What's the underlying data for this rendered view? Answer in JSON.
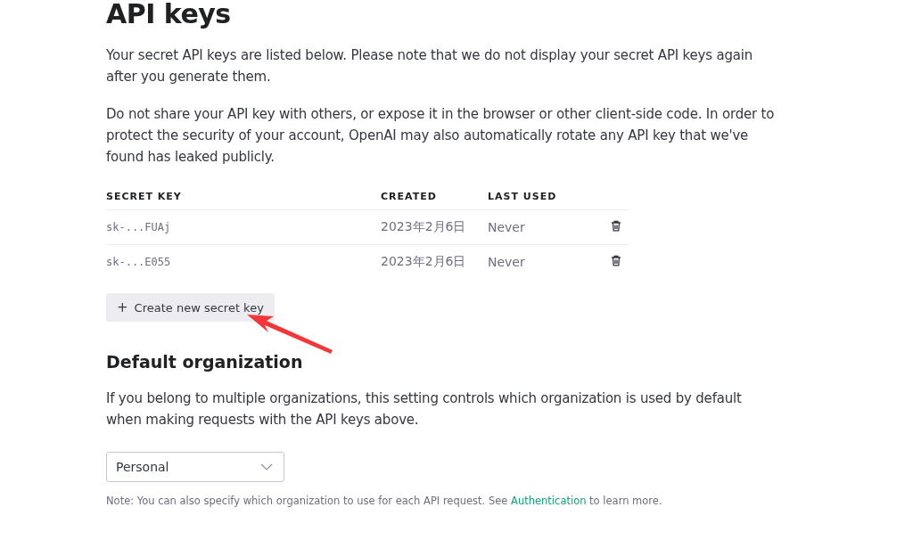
{
  "title": "API keys",
  "paragraphs": [
    "Your secret API keys are listed below. Please note that we do not display your secret API keys again after you generate them.",
    "Do not share your API key with others, or expose it in the browser or other client-side code. In order to protect the security of your account, OpenAI may also automatically rotate any API key that we've found has leaked publicly."
  ],
  "table": {
    "columns": [
      "SECRET KEY",
      "CREATED",
      "LAST USED"
    ],
    "rows": [
      {
        "key": "sk-...FUAj",
        "created": "2023年2月6日",
        "last_used": "Never"
      },
      {
        "key": "sk-...E055",
        "created": "2023年2月6日",
        "last_used": "Never"
      }
    ]
  },
  "create_button": {
    "icon": "+",
    "label": "Create new secret key"
  },
  "default_organization": {
    "heading": "Default organization",
    "description": "If you belong to multiple organizations, this setting controls which organization is used by default when making requests with the API keys above.",
    "select": {
      "value": "Personal"
    },
    "note": {
      "before": "Note: You can also specify which organization to use for each API request. See ",
      "link": "Authentication",
      "after": " to learn more."
    }
  }
}
